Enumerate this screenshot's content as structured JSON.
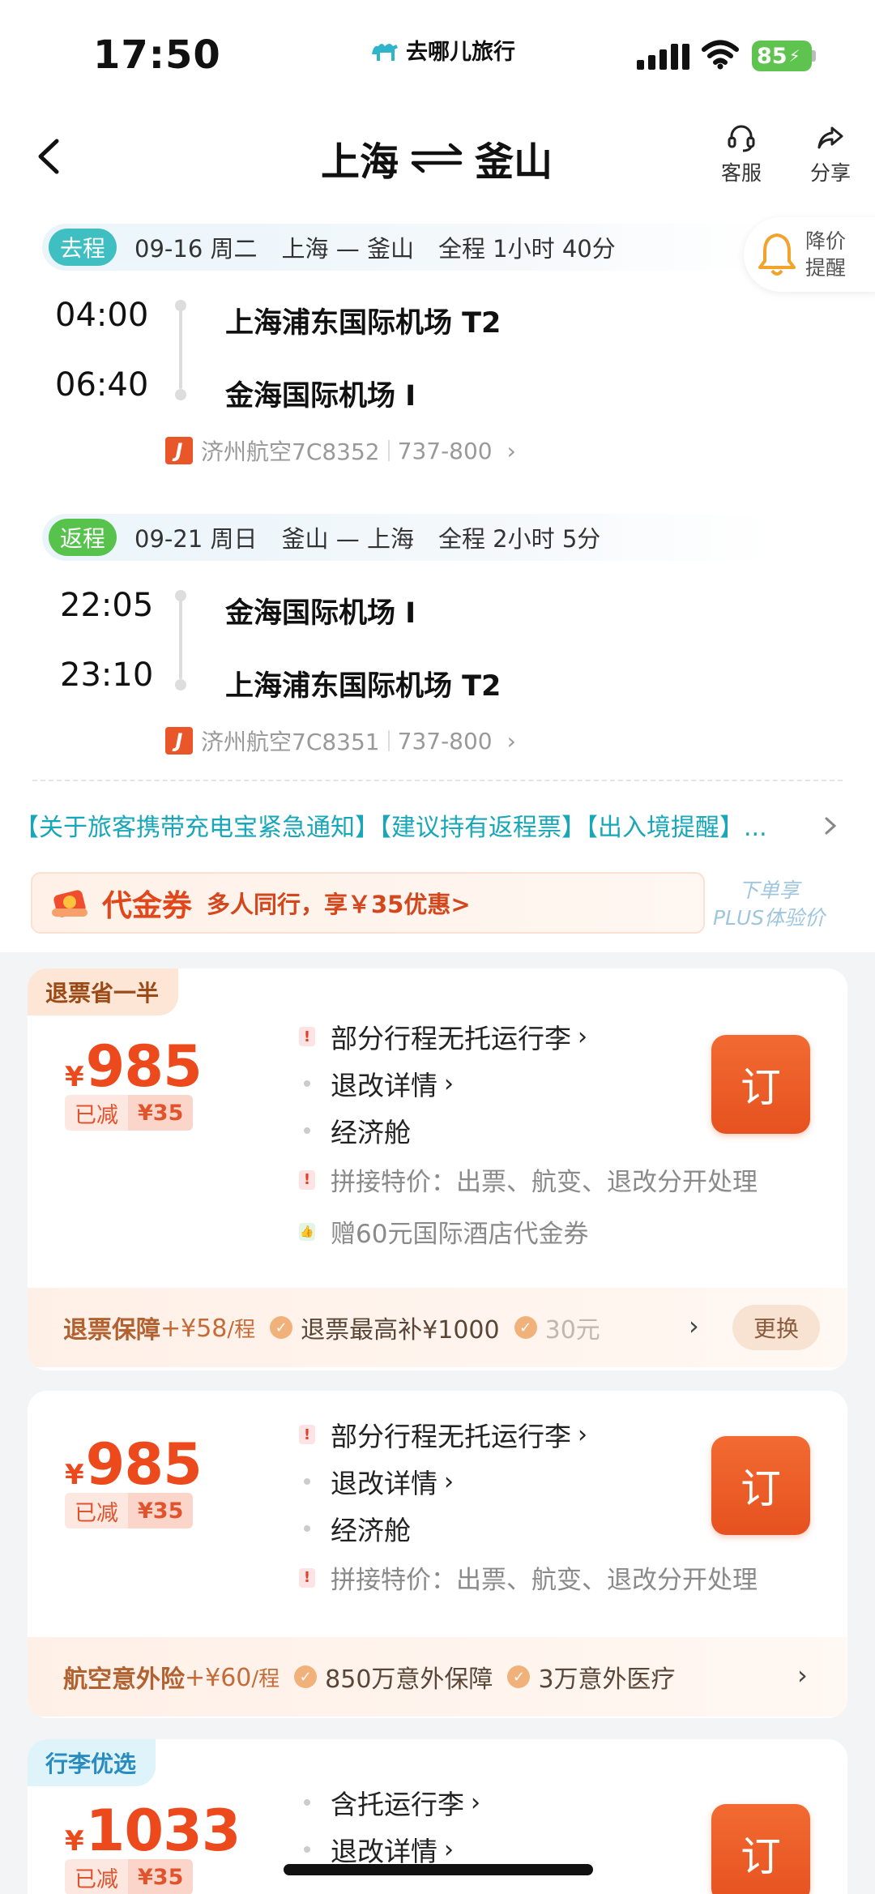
{
  "status": {
    "time": "17:50",
    "brand": "去哪儿旅行",
    "battery": "85"
  },
  "header": {
    "from": "上海",
    "to": "釜山",
    "service_label": "客服",
    "share_label": "分享"
  },
  "price_alert": {
    "line1": "降价",
    "line2": "提醒"
  },
  "outbound": {
    "tag": "去程",
    "date": "09-16 周二",
    "route": "上海 — 釜山",
    "duration": "全程 1小时 40分",
    "dep_time": "04:00",
    "dep_airport": "上海浦东国际机场 T2",
    "arr_time": "06:40",
    "arr_airport": "金海国际机场 I",
    "airline": "济州航空7C8352",
    "aircraft": "737-800"
  },
  "inbound": {
    "tag": "返程",
    "date": "09-21 周日",
    "route": "釜山 — 上海",
    "duration": "全程 2小时 5分",
    "dep_time": "22:05",
    "dep_airport": "金海国际机场 I",
    "arr_time": "23:10",
    "arr_airport": "上海浦东国际机场 T2",
    "airline": "济州航空7C8351",
    "aircraft": "737-800"
  },
  "notice": "【关于旅客携带充电宝紧急通知】【建议持有返程票】【出入境提醒】...",
  "voucher": {
    "title": "代金券",
    "desc": "多人同行，享￥35优惠>",
    "plus_line1": "下单享",
    "plus_line2": "PLUS体验价"
  },
  "cards": [
    {
      "badge": "退票省一半",
      "currency": "¥",
      "price": "985",
      "reduced_label": "已减",
      "reduced_amount": "¥35",
      "features": [
        "部分行程无托运行李",
        "退改详情",
        "经济舱",
        "拼接特价：出票、航变、退改分开处理",
        "赠60元国际酒店代金券"
      ],
      "book": "订",
      "ins_title": "退票保障",
      "ins_price": "+¥58",
      "ins_unit": "/程",
      "ins_item1": "退票最高补¥1000",
      "ins_item2": "30元",
      "change": "更换"
    },
    {
      "currency": "¥",
      "price": "985",
      "reduced_label": "已减",
      "reduced_amount": "¥35",
      "features": [
        "部分行程无托运行李",
        "退改详情",
        "经济舱",
        "拼接特价：出票、航变、退改分开处理"
      ],
      "book": "订",
      "ins_title": "航空意外险",
      "ins_price": "+¥60",
      "ins_unit": "/程",
      "ins_item1": "850万意外保障",
      "ins_item2": "3万意外医疗"
    },
    {
      "badge": "行李优选",
      "currency": "¥",
      "price": "1033",
      "reduced_label": "已减",
      "reduced_amount": "¥35",
      "features": [
        "含托运行李",
        "退改详情"
      ],
      "book": "订"
    }
  ]
}
